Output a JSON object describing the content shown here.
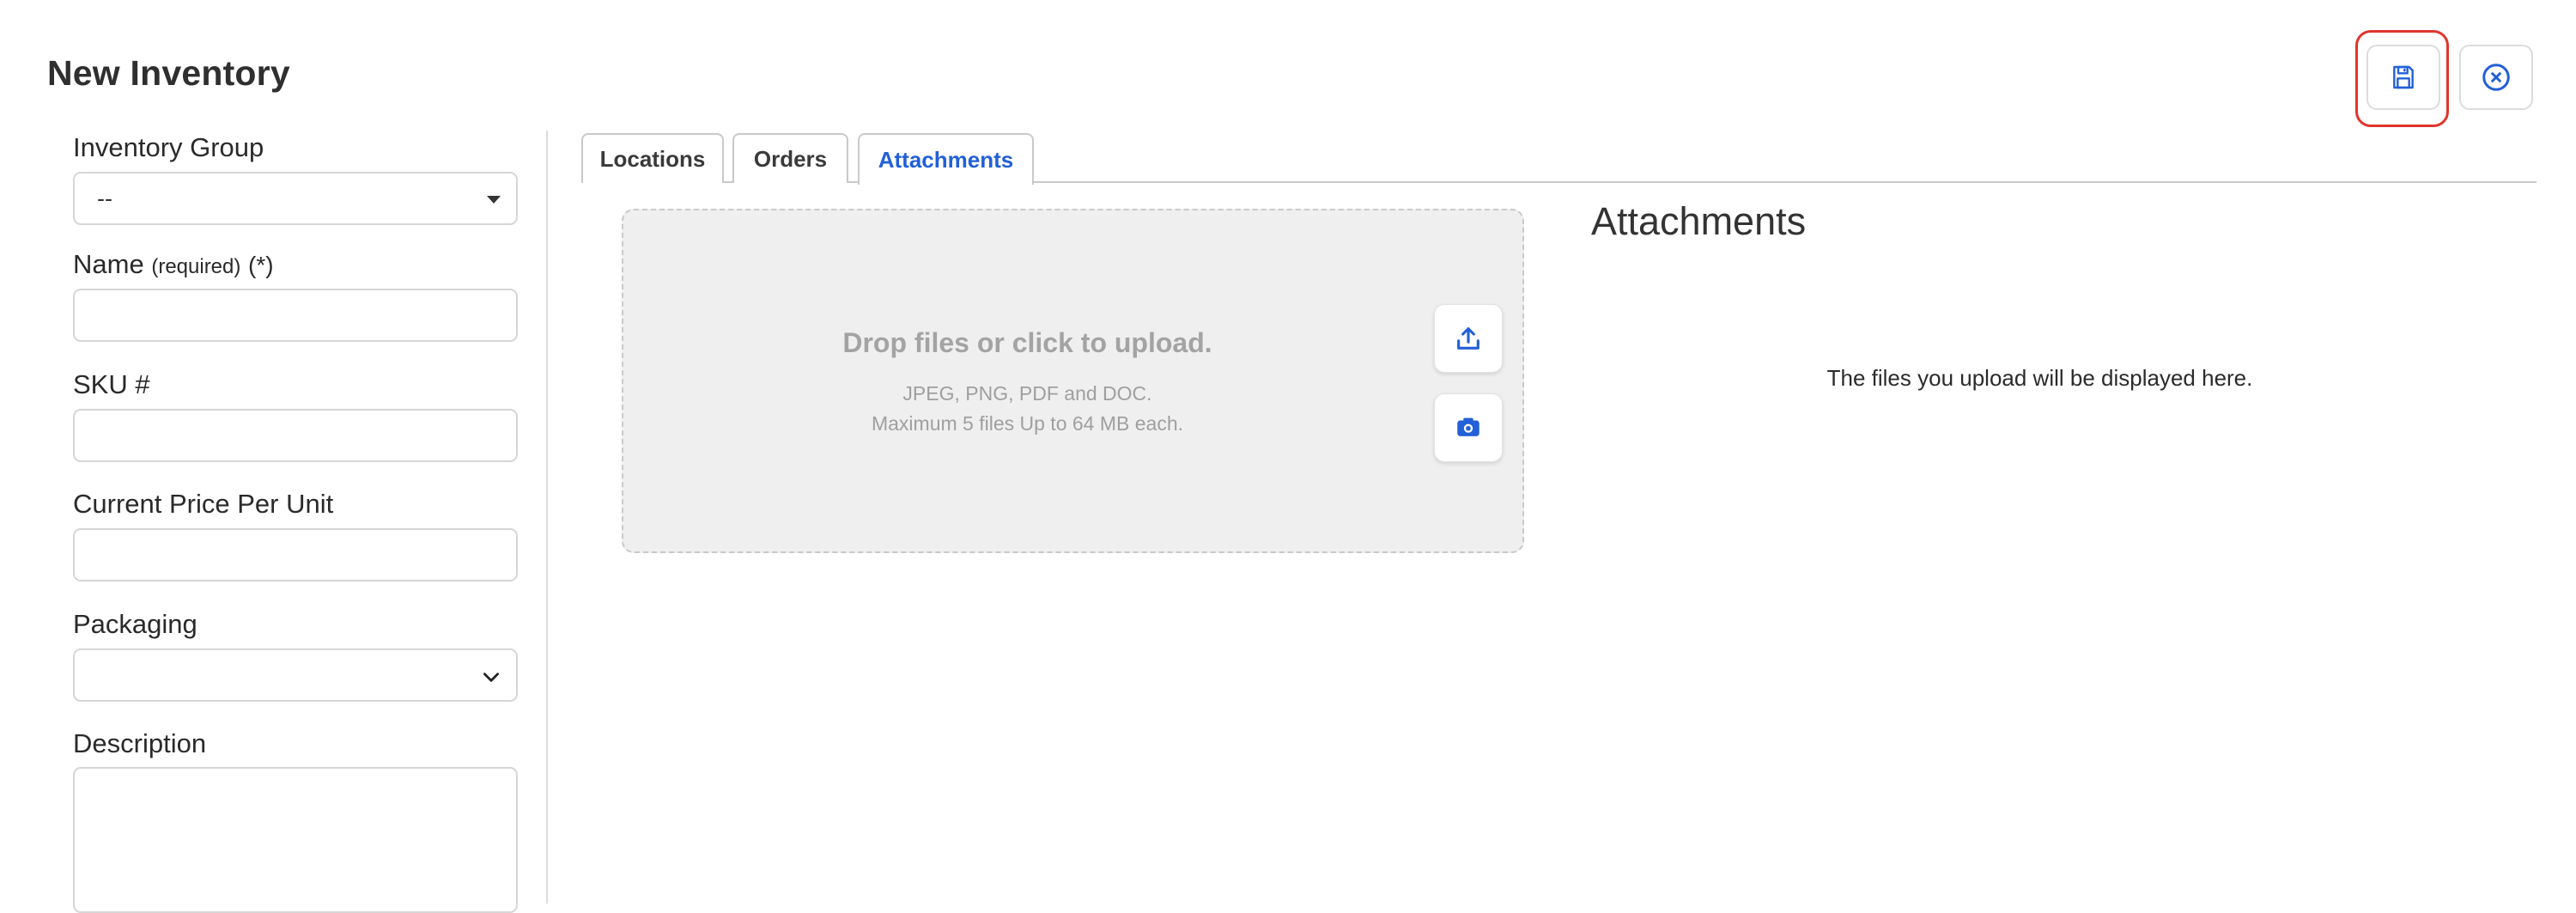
{
  "header": {
    "title": "New Inventory"
  },
  "form": {
    "inventory_group": {
      "label": "Inventory Group",
      "value": "--"
    },
    "name": {
      "label": "Name",
      "required_text": "(required)",
      "required_mark": "(*)",
      "value": ""
    },
    "sku": {
      "label": "SKU #",
      "value": ""
    },
    "price": {
      "label": "Current Price Per Unit",
      "value": ""
    },
    "packaging": {
      "label": "Packaging",
      "value": ""
    },
    "description": {
      "label": "Description",
      "value": ""
    }
  },
  "tabs": [
    {
      "label": "Locations",
      "active": false
    },
    {
      "label": "Orders",
      "active": false
    },
    {
      "label": "Attachments",
      "active": true
    }
  ],
  "dropzone": {
    "title": "Drop files or click to upload.",
    "formats": "JPEG, PNG, PDF and DOC.",
    "limits": "Maximum 5 files Up to 64 MB each."
  },
  "attachments": {
    "title": "Attachments",
    "empty_text": "The files you upload will be displayed here."
  },
  "colors": {
    "accent": "#2260d8",
    "highlight": "#e0352b",
    "dropzone_bg": "#efefef"
  },
  "icons": {
    "save": "floppy-disk-icon",
    "close": "circle-x-icon",
    "upload": "upload-icon",
    "camera": "camera-icon"
  }
}
